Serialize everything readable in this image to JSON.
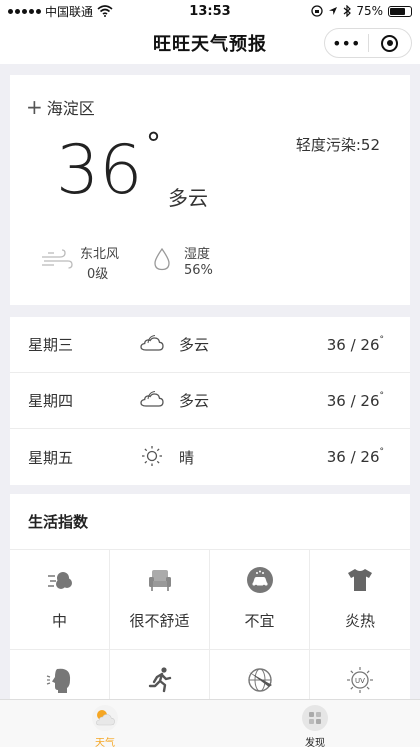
{
  "status_bar": {
    "carrier": "中国联通",
    "time": "13:53",
    "battery": "75%"
  },
  "nav": {
    "title": "旺旺天气预报",
    "menu_label": "•••"
  },
  "current": {
    "location": "海淀区",
    "pollution": "轻度污染:52",
    "temperature": "36",
    "degree_symbol": "°",
    "condition": "多云",
    "wind_direction": "东北风",
    "wind_level": "0级",
    "humidity_label": "湿度",
    "humidity_value": "56%"
  },
  "forecast": [
    {
      "day": "星期三",
      "icon": "cloud-icon",
      "condition": "多云",
      "temp": "36 / 26",
      "unit": "°"
    },
    {
      "day": "星期四",
      "icon": "cloud-icon",
      "condition": "多云",
      "temp": "36 / 26",
      "unit": "°"
    },
    {
      "day": "星期五",
      "icon": "sun-icon",
      "condition": "晴",
      "temp": "36 / 26",
      "unit": "°"
    }
  ],
  "life_index": {
    "title": "生活指数",
    "items": [
      {
        "icon": "wind-puff-icon",
        "label": "中"
      },
      {
        "icon": "armchair-icon",
        "label": "很不舒适"
      },
      {
        "icon": "car-wash-icon",
        "label": "不宜"
      },
      {
        "icon": "tshirt-icon",
        "label": "炎热"
      },
      {
        "icon": "head-cold-icon",
        "label": ""
      },
      {
        "icon": "running-icon",
        "label": ""
      },
      {
        "icon": "globe-plane-icon",
        "label": ""
      },
      {
        "icon": "uv-icon",
        "label": ""
      }
    ]
  },
  "tabbar": {
    "weather_label": "天气",
    "discover_label": "发现"
  },
  "colors": {
    "accent": "#f5a623",
    "background": "#efeff4"
  }
}
